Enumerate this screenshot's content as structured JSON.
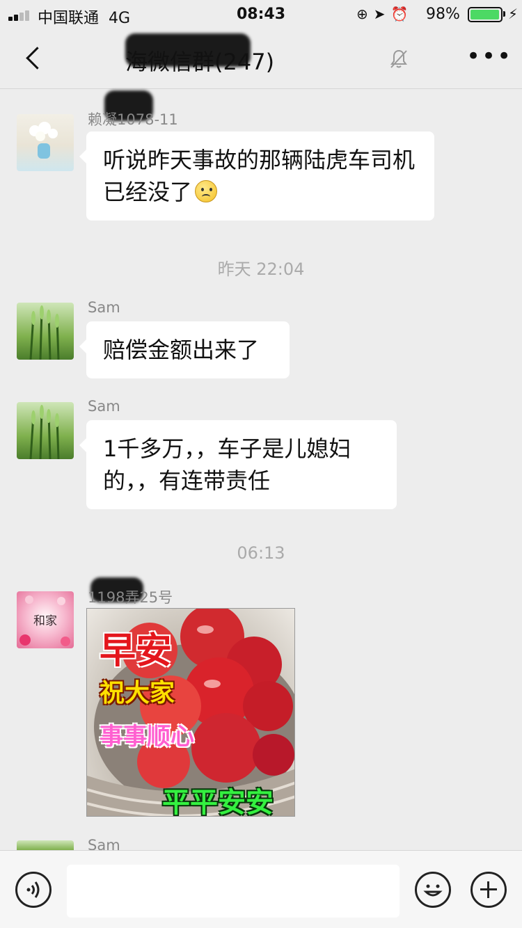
{
  "status_bar": {
    "carrier": "中国联通",
    "network": "4G",
    "time": "08:43",
    "battery_percent": "98%",
    "battery_level": 0.98
  },
  "nav": {
    "title": "海微信群(247)",
    "back_icon": "chevron-left-icon",
    "mute_icon": "bell-off-icon",
    "more_icon": "more-horizontal-icon"
  },
  "messages": [
    {
      "sender": "赖凝1078-11",
      "text": "听说昨天事故的那辆陆虎车司机已经没了",
      "emoji": "sad-face-emoji"
    },
    {
      "timestamp": "昨天 22:04"
    },
    {
      "sender": "Sam",
      "text": "赔偿金额出来了"
    },
    {
      "sender": "Sam",
      "text": "1千多万，，车子是儿媳妇的，，有连带责任"
    },
    {
      "timestamp": "06:13"
    },
    {
      "sender": "1198弄25号",
      "avatar_text": "和家",
      "sticker": {
        "line1": "早安",
        "line2": "祝大家",
        "line3": "事事顺心",
        "line4": "平平安安"
      }
    },
    {
      "sender": "Sam"
    }
  ],
  "colors": {
    "background": "#ededed",
    "bubble": "#ffffff",
    "battery_green": "#4cd964"
  }
}
